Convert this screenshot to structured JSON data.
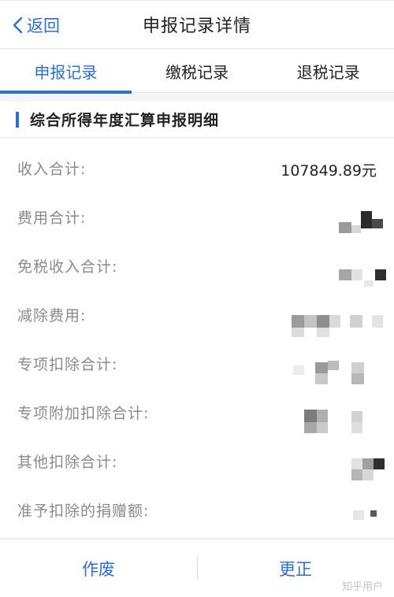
{
  "nav": {
    "back_label": "返回",
    "title": "申报记录详情"
  },
  "tabs": [
    {
      "label": "申报记录",
      "active": true
    },
    {
      "label": "缴税记录",
      "active": false
    },
    {
      "label": "退税记录",
      "active": false
    }
  ],
  "section": {
    "title": "综合所得年度汇算申报明细"
  },
  "rows": [
    {
      "label": "收入合计:",
      "value": "107849.89元"
    },
    {
      "label": "费用合计:",
      "value": null,
      "redacted": true
    },
    {
      "label": "免税收入合计:",
      "value": null,
      "redacted": true
    },
    {
      "label": "减除费用:",
      "value": null,
      "redacted": true
    },
    {
      "label": "专项扣除合计:",
      "value": null,
      "redacted": true
    },
    {
      "label": "专项附加扣除合计:",
      "value": null,
      "redacted": true
    },
    {
      "label": "其他扣除合计:",
      "value": null,
      "redacted": true
    },
    {
      "label": "准予扣除的捐赠额:",
      "value": null,
      "redacted": true
    }
  ],
  "footer": {
    "void_label": "作废",
    "correct_label": "更正",
    "watermark": "知乎用户"
  },
  "colors": {
    "accent": "#2a6fd6",
    "label": "#8a8a8a",
    "background": "#f5f5f5"
  }
}
